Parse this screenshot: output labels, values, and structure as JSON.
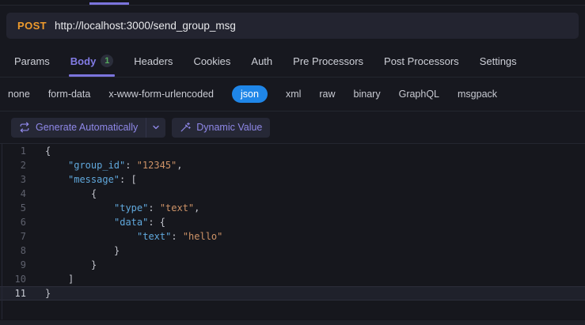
{
  "request_bar": {
    "method": "POST",
    "url": "http://localhost:3000/send_group_msg"
  },
  "tabs": {
    "items": [
      {
        "label": "Params"
      },
      {
        "label": "Body",
        "badge": "1",
        "active": true
      },
      {
        "label": "Headers"
      },
      {
        "label": "Cookies"
      },
      {
        "label": "Auth"
      },
      {
        "label": "Pre Processors"
      },
      {
        "label": "Post Processors"
      },
      {
        "label": "Settings"
      }
    ]
  },
  "body_types": {
    "options": [
      "none",
      "form-data",
      "x-www-form-urlencoded",
      "json",
      "xml",
      "raw",
      "binary",
      "GraphQL",
      "msgpack"
    ],
    "selected": "json"
  },
  "toolbar": {
    "generate_label": "Generate Automatically",
    "dynamic_label": "Dynamic Value",
    "icons": [
      "refresh-icon",
      "chevron-down-icon",
      "wand-icon"
    ]
  },
  "editor": {
    "language": "json",
    "active_line": 11,
    "colors": {
      "key": "#61a9dd",
      "str": "#ce9367",
      "punc": "#c2c4cc"
    },
    "lines": [
      {
        "n": 1,
        "indent": 0,
        "tokens": [
          {
            "t": "punc",
            "v": "{"
          }
        ]
      },
      {
        "n": 2,
        "indent": 1,
        "tokens": [
          {
            "t": "key",
            "v": "\"group_id\""
          },
          {
            "t": "punc",
            "v": ": "
          },
          {
            "t": "str",
            "v": "\"12345\""
          },
          {
            "t": "punc",
            "v": ","
          }
        ]
      },
      {
        "n": 3,
        "indent": 1,
        "tokens": [
          {
            "t": "key",
            "v": "\"message\""
          },
          {
            "t": "punc",
            "v": ": ["
          }
        ]
      },
      {
        "n": 4,
        "indent": 2,
        "tokens": [
          {
            "t": "punc",
            "v": "{"
          }
        ]
      },
      {
        "n": 5,
        "indent": 3,
        "tokens": [
          {
            "t": "key",
            "v": "\"type\""
          },
          {
            "t": "punc",
            "v": ": "
          },
          {
            "t": "str",
            "v": "\"text\""
          },
          {
            "t": "punc",
            "v": ","
          }
        ]
      },
      {
        "n": 6,
        "indent": 3,
        "tokens": [
          {
            "t": "key",
            "v": "\"data\""
          },
          {
            "t": "punc",
            "v": ": {"
          }
        ]
      },
      {
        "n": 7,
        "indent": 4,
        "tokens": [
          {
            "t": "key",
            "v": "\"text\""
          },
          {
            "t": "punc",
            "v": ": "
          },
          {
            "t": "str",
            "v": "\"hello\""
          }
        ]
      },
      {
        "n": 8,
        "indent": 3,
        "tokens": [
          {
            "t": "punc",
            "v": "}"
          }
        ]
      },
      {
        "n": 9,
        "indent": 2,
        "tokens": [
          {
            "t": "punc",
            "v": "}"
          }
        ]
      },
      {
        "n": 10,
        "indent": 1,
        "tokens": [
          {
            "t": "punc",
            "v": "]"
          }
        ]
      },
      {
        "n": 11,
        "indent": 0,
        "tokens": [
          {
            "t": "punc",
            "v": "}"
          }
        ]
      }
    ]
  },
  "colors": {
    "accent_purple": "#7b74dd",
    "method_orange": "#ef9b2d",
    "selected_blue": "#1f86e8",
    "badge_green": "#56ab5e",
    "editor_key_blue": "#61a9dd",
    "editor_string_orange": "#ce9367"
  }
}
